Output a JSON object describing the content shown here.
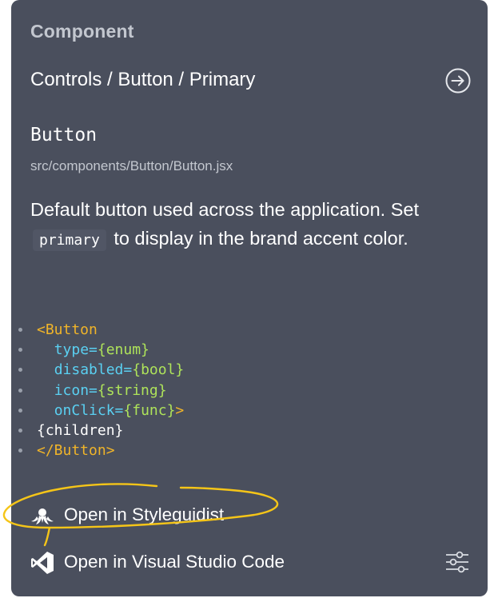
{
  "panel": {
    "section_label": "Component",
    "path": "Controls / Button / Primary",
    "component_name": "Button",
    "file_path": "src/components/Button/Button.jsx",
    "description": {
      "before": "Default button used across the application. Set",
      "code": "primary",
      "after": "to display in the brand accent color."
    }
  },
  "code": {
    "open_tag": "<Button",
    "props": [
      {
        "name": "type=",
        "value": "{enum}"
      },
      {
        "name": "disabled=",
        "value": "{bool}"
      },
      {
        "name": "icon=",
        "value": "{string}"
      },
      {
        "name": "onClick=",
        "value": "{func}",
        "suffix": ">"
      }
    ],
    "children": "{children}",
    "close_tag": "</Button>"
  },
  "actions": {
    "styleguidist": "Open in Styleguidist",
    "vscode": "Open in Visual Studio Code"
  },
  "colors": {
    "panel_bg": "#4a4f5d",
    "tag": "#f0b429",
    "prop": "#5ad0f2",
    "value": "#aee35a",
    "highlight": "#f5c518"
  },
  "icons": {
    "navigate": "arrow-circle-right-icon",
    "styleguidist": "styleguidist-logo-icon",
    "vscode": "vscode-logo-icon",
    "settings": "sliders-icon"
  }
}
